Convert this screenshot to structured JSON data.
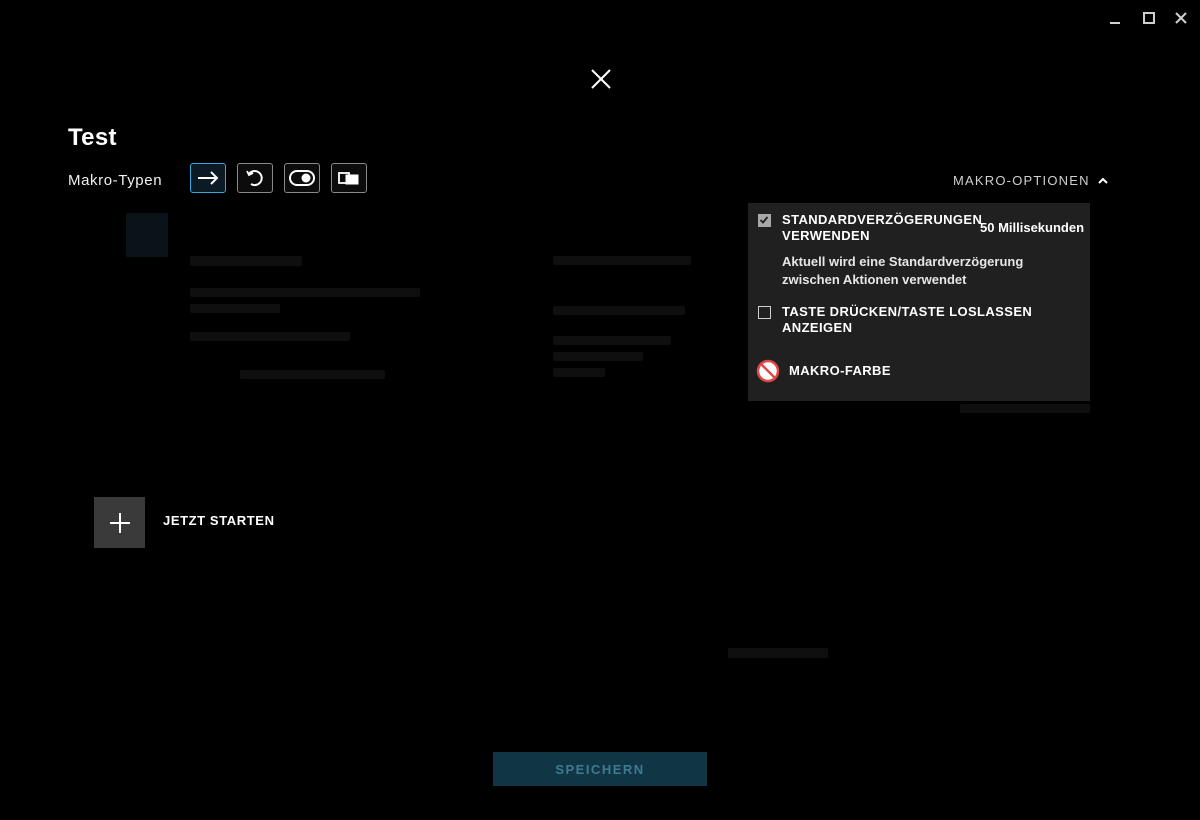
{
  "window": {
    "minimize_icon": "minimize-icon",
    "maximize_icon": "maximize-icon",
    "close_icon": "close-icon"
  },
  "editor": {
    "title": "Test",
    "types_label": "Makro-Typen",
    "macro_types": [
      {
        "icon": "arrow-right-icon",
        "active": true
      },
      {
        "icon": "repeat-icon",
        "active": false
      },
      {
        "icon": "toggle-icon",
        "active": false
      },
      {
        "icon": "sequence-icon",
        "active": false
      }
    ]
  },
  "options": {
    "toggle_label": "MAKRO-OPTIONEN",
    "default_delay": {
      "label": "STANDARDVERZÖGERUNGEN VERWENDEN",
      "checked": true,
      "value": "50 Millisekunden",
      "description": "Aktuell wird eine Standardverzögerung zwischen Aktionen verwendet"
    },
    "press_release": {
      "label": "TASTE DRÜCKEN/TASTE LOSLASSEN ANZEIGEN",
      "checked": false
    },
    "color": {
      "label": "MAKRO-FARBE",
      "icon": "no-color-icon"
    }
  },
  "start": {
    "label": "JETZT STARTEN"
  },
  "footer": {
    "save_label": "SPEICHERN"
  },
  "colors": {
    "accent": "#35a8e0",
    "panel": "#202020",
    "save_bg": "#103544",
    "save_text": "#3f7a90"
  }
}
